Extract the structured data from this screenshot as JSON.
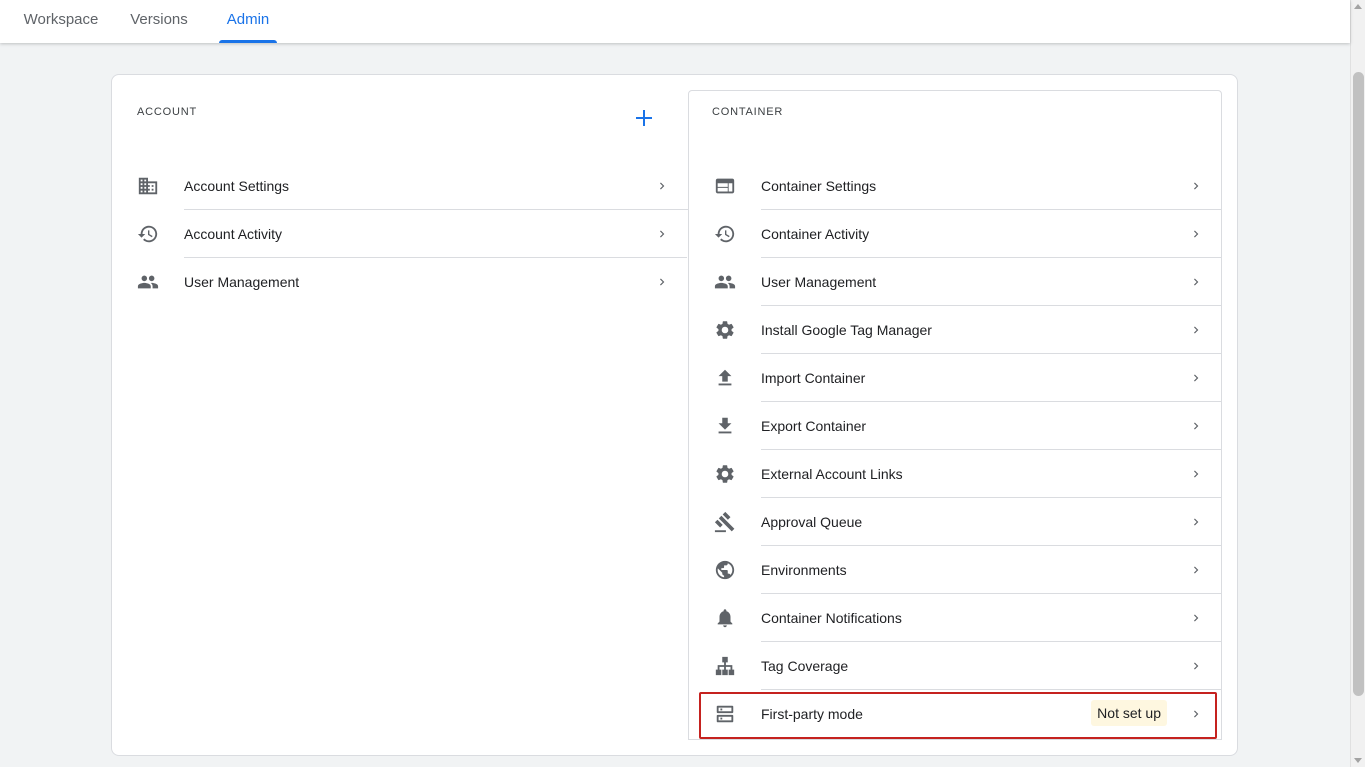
{
  "tabs": [
    {
      "label": "Workspace"
    },
    {
      "label": "Versions"
    },
    {
      "label": "Admin",
      "active": true
    }
  ],
  "account": {
    "heading": "ACCOUNT",
    "items": [
      {
        "label": "Account Settings",
        "icon": "building-icon"
      },
      {
        "label": "Account Activity",
        "icon": "history-icon"
      },
      {
        "label": "User Management",
        "icon": "people-icon"
      }
    ]
  },
  "container": {
    "heading": "CONTAINER",
    "items": [
      {
        "label": "Container Settings",
        "icon": "browser-window-icon"
      },
      {
        "label": "Container Activity",
        "icon": "history-icon"
      },
      {
        "label": "User Management",
        "icon": "people-icon"
      },
      {
        "label": "Install Google Tag Manager",
        "icon": "gear-icon"
      },
      {
        "label": "Import Container",
        "icon": "upload-icon"
      },
      {
        "label": "Export Container",
        "icon": "download-icon"
      },
      {
        "label": "External Account Links",
        "icon": "gear-icon"
      },
      {
        "label": "Approval Queue",
        "icon": "gavel-icon"
      },
      {
        "label": "Environments",
        "icon": "globe-icon"
      },
      {
        "label": "Container Notifications",
        "icon": "bell-icon"
      },
      {
        "label": "Tag Coverage",
        "icon": "hierarchy-icon"
      },
      {
        "label": "First-party mode",
        "icon": "server-icon",
        "badge": "Not set up"
      }
    ]
  },
  "colors": {
    "accent": "#1a73e8",
    "highlight": "#c5221f",
    "badge_bg": "#fef7e0"
  }
}
